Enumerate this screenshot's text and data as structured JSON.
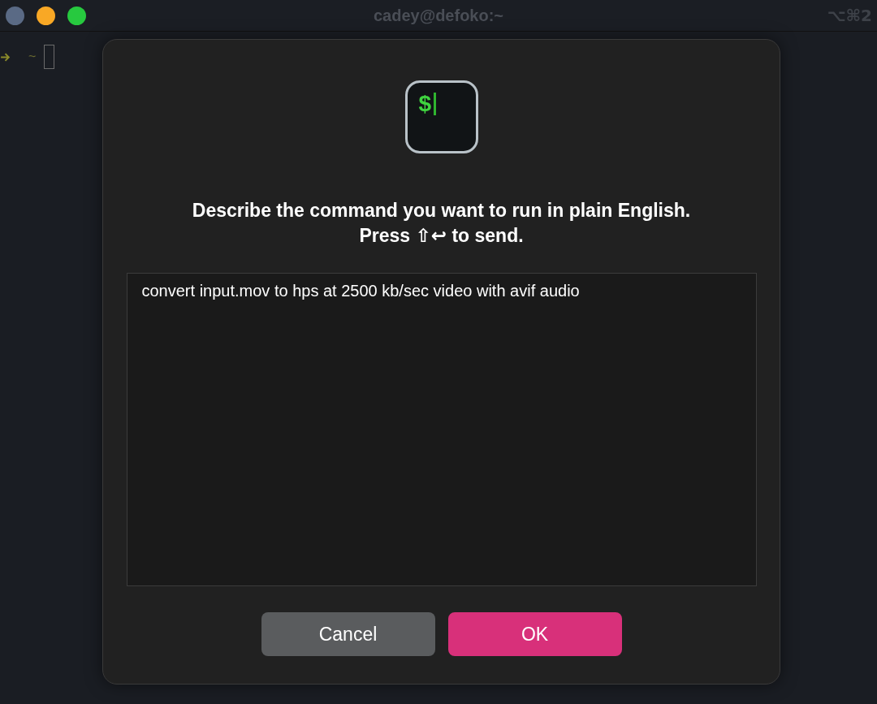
{
  "window": {
    "title": "cadey@defoko:~",
    "shortcut": "⌥⌘2"
  },
  "terminal": {
    "prompt": "~"
  },
  "dialog": {
    "app_icon": {
      "glyph": "$"
    },
    "heading": [
      "Describe the command you want to run in plain English.",
      "Press ⇧↩ to send."
    ],
    "input": {
      "value": "convert input.mov to hps at 2500 kb/sec video with avif audio"
    },
    "buttons": [
      {
        "label": "Cancel",
        "kind": "secondary"
      },
      {
        "label": "OK",
        "kind": "primary"
      }
    ]
  }
}
